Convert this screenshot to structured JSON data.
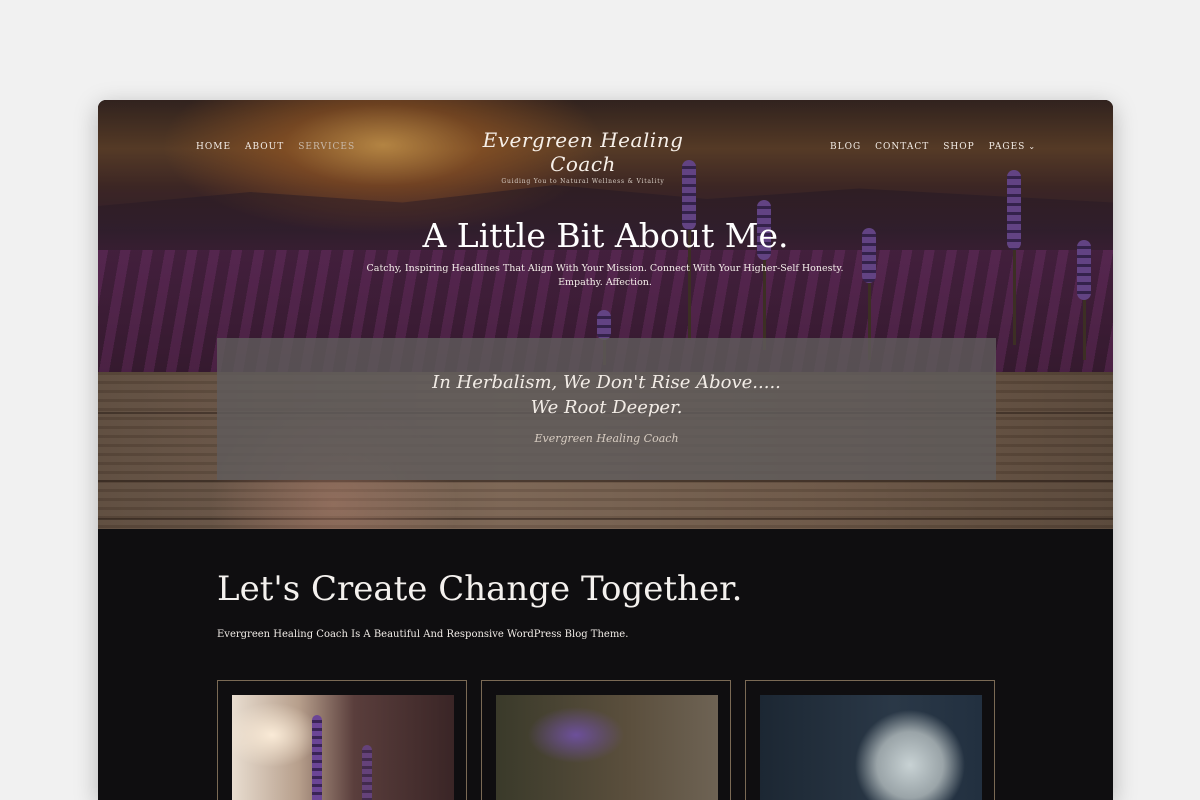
{
  "nav": {
    "left": [
      "HOME",
      "ABOUT",
      "SERVICES"
    ],
    "right": [
      "BLOG",
      "CONTACT",
      "SHOP",
      "PAGES"
    ],
    "caret_icon": "chevron-down-icon"
  },
  "logo": {
    "title": "Evergreen Healing Coach",
    "tagline": "Guiding You to Natural Wellness & Vitality"
  },
  "hero": {
    "title": "A Little Bit About Me.",
    "subtitle": "Catchy, Inspiring Headlines That Align With Your Mission. Connect With Your Higher-Self Honesty. Empathy. Affection."
  },
  "quote": {
    "line1": "In Herbalism, We Don't Rise Above.....",
    "line2": "We Root Deeper.",
    "author": "Evergreen Healing Coach"
  },
  "section": {
    "title": "Let's Create Change Together.",
    "subtitle": "Evergreen Healing Coach Is A Beautiful And Responsive WordPress Blog Theme."
  },
  "colors": {
    "background": "#f1f1f1",
    "page_dark": "#0f0e10",
    "quote_box": "#5f5c5c",
    "card_border": "#7a6a55",
    "accent_lavender": "#7d56a8"
  }
}
